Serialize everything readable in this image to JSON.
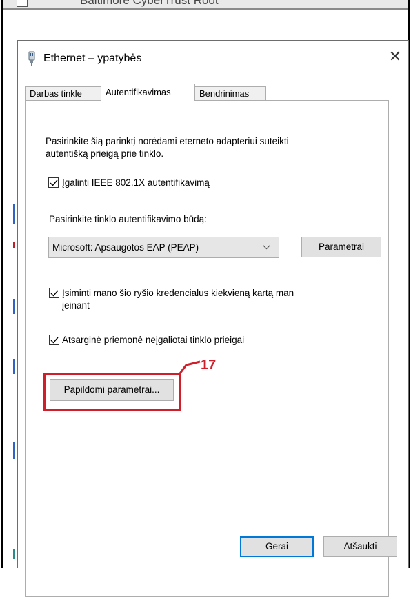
{
  "background_window": {
    "title_fragment": "Baltimore CyberTrust Root"
  },
  "dialog": {
    "title": "Ethernet – ypatybės",
    "close_glyph": "✕",
    "tabs": [
      {
        "label": "Darbas tinkle",
        "active": false
      },
      {
        "label": "Autentifikavimas",
        "active": true
      },
      {
        "label": "Bendrinimas",
        "active": false
      }
    ],
    "description_line1": "Pasirinkite šią parinktį norėdami eterneto adapteriui suteikti",
    "description_line2": "autentišką prieigą prie tinklo.",
    "enable_8021x": {
      "label": "Įgalinti IEEE 802.1X autentifikavimą",
      "checked": true
    },
    "method_label": "Pasirinkite tinklo autentifikavimo būdą:",
    "method_select": {
      "value": "Microsoft: Apsaugotos EAP (PEAP)"
    },
    "settings_button": "Parametrai",
    "remember_credentials": {
      "label_line1": "Įsiminti mano šio ryšio kredencialus kiekvieną kartą man",
      "label_line2": "įeinant",
      "checked": true
    },
    "fallback_unauthorized": {
      "label": "Atsarginė priemonė neįgaliotai tinklo prieigai",
      "checked": true
    },
    "additional_settings_button": "Papildomi parametrai...",
    "ok_button": "Gerai",
    "cancel_button": "Atšaukti"
  },
  "annotation": {
    "step_number": "17",
    "color": "#d01f2b"
  },
  "colors": {
    "accent_default_button": "#0078d7",
    "annotation_red": "#d01f2b"
  }
}
